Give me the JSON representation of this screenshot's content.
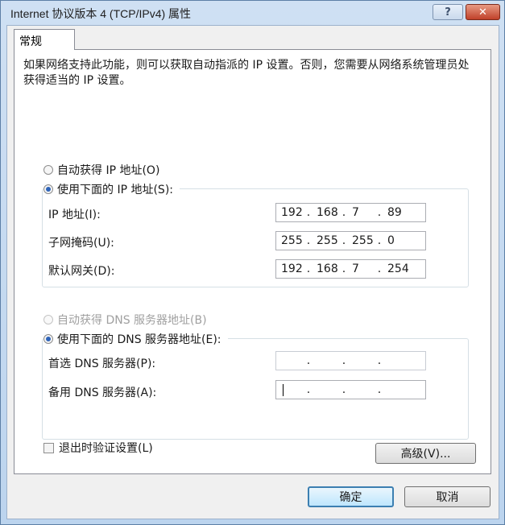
{
  "window": {
    "title": "Internet 协议版本 4 (TCP/IPv4) 属性",
    "help_label": "?",
    "close_label": "✕"
  },
  "tabs": [
    {
      "label": "常规",
      "active": true
    }
  ],
  "description": "如果网络支持此功能，则可以获取自动指派的 IP 设置。否则，您需要从网络系统管理员处获得适当的 IP 设置。",
  "ip_section": {
    "auto_label": "自动获得 IP 地址(O)",
    "auto_selected": false,
    "manual_label": "使用下面的 IP 地址(S):",
    "manual_selected": true,
    "fields": [
      {
        "label": "IP 地址(I):",
        "octets": [
          "192",
          "168",
          "7",
          "89"
        ]
      },
      {
        "label": "子网掩码(U):",
        "octets": [
          "255",
          "255",
          "255",
          "0"
        ]
      },
      {
        "label": "默认网关(D):",
        "octets": [
          "192",
          "168",
          "7",
          "254"
        ]
      }
    ]
  },
  "dns_section": {
    "auto_label": "自动获得 DNS 服务器地址(B)",
    "auto_selected": false,
    "auto_disabled": true,
    "manual_label": "使用下面的 DNS 服务器地址(E):",
    "manual_selected": true,
    "fields": [
      {
        "label": "首选 DNS 服务器(P):",
        "octets": [
          "",
          "",
          "",
          ""
        ]
      },
      {
        "label": "备用 DNS 服务器(A):",
        "octets": [
          "",
          "",
          "",
          ""
        ]
      }
    ]
  },
  "validate_checkbox": {
    "label": "退出时验证设置(L)",
    "checked": false
  },
  "buttons": {
    "advanced": "高级(V)...",
    "ok": "确定",
    "cancel": "取消"
  },
  "colors": {
    "accent": "#2f64b9",
    "default_button_border": "#3c7fb1",
    "close_button": "#c0412a"
  }
}
